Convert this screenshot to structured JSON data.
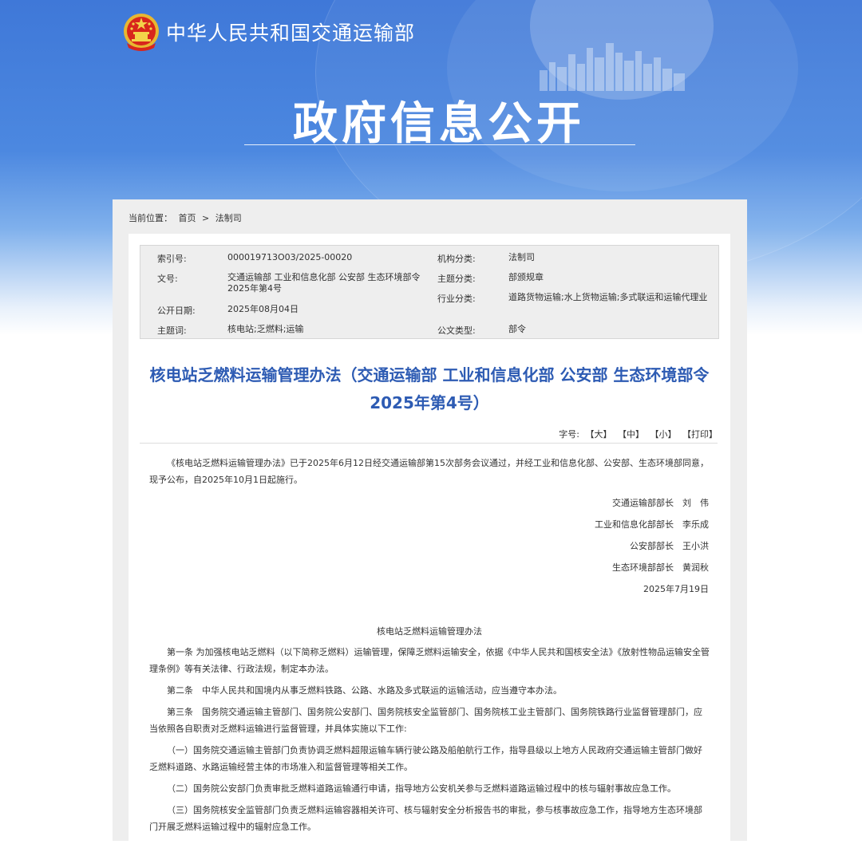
{
  "header": {
    "site_name": "中华人民共和国交通运输部",
    "title": "政府信息公开"
  },
  "breadcrumb": {
    "label": "当前位置：",
    "home": "首页",
    "separator": ">",
    "current": "法制司"
  },
  "meta": {
    "index_label": "索引号:",
    "index_value": "000019713O03/2025-00020",
    "org_label": "机构分类:",
    "org_value": "法制司",
    "docno_label": "文号:",
    "docno_value": "交通运输部 工业和信息化部 公安部 生态环境部令2025年第4号",
    "topic_label": "主题分类:",
    "topic_value": "部颁规章",
    "industry_label": "行业分类:",
    "industry_value": "道路货物运输;水上货物运输;多式联运和运输代理业",
    "date_label": "公开日期:",
    "date_value": "2025年08月04日",
    "keywords_label": "主题词:",
    "keywords_value": "核电站;乏燃料;运输",
    "type_label": "公文类型:",
    "type_value": "部令"
  },
  "article": {
    "title": "核电站乏燃料运输管理办法（交通运输部 工业和信息化部 公安部 生态环境部令2025年第4号）",
    "font_label": "字号:",
    "font_large": "【大】",
    "font_medium": "【中】",
    "font_small": "【小】",
    "print": "【打印】",
    "intro": "《核电站乏燃料运输管理办法》已于2025年6月12日经交通运输部第15次部务会议通过，并经工业和信息化部、公安部、生态环境部同意，现予公布，自2025年10月1日起施行。",
    "signatures": [
      "交通运输部部长　刘　伟",
      "工业和信息化部部长　李乐成",
      "公安部部长　王小洪",
      "生态环境部部长　黄润秋",
      "2025年7月19日"
    ],
    "law_title": "核电站乏燃料运输管理办法",
    "paragraphs": [
      "第一条 为加强核电站乏燃料（以下简称乏燃料）运输管理，保障乏燃料运输安全，依据《中华人民共和国核安全法》《放射性物品运输安全管理条例》等有关法律、行政法规，制定本办法。",
      "第二条　中华人民共和国境内从事乏燃料铁路、公路、水路及多式联运的运输活动，应当遵守本办法。",
      "第三条　国务院交通运输主管部门、国务院公安部门、国务院核安全监管部门、国务院核工业主管部门、国务院铁路行业监督管理部门，应当依照各自职责对乏燃料运输进行监督管理，并具体实施以下工作:",
      "（一）国务院交通运输主管部门负责协调乏燃料超限运输车辆行驶公路及船舶航行工作，指导县级以上地方人民政府交通运输主管部门做好乏燃料道路、水路运输经营主体的市场准入和监督管理等相关工作。",
      "（二）国务院公安部门负责审批乏燃料道路运输通行申请，指导地方公安机关参与乏燃料道路运输过程中的核与辐射事故应急工作。",
      "（三）国务院核安全监管部门负责乏燃料运输容器相关许可、核与辐射安全分析报告书的审批，参与核事故应急工作，指导地方生态环境部门开展乏燃料运输过程中的辐射应急工作。"
    ]
  },
  "colors": {
    "banner_blue": "#4c88e0",
    "title_blue": "#2d5bb3",
    "panel_gray": "#eeeeee"
  }
}
